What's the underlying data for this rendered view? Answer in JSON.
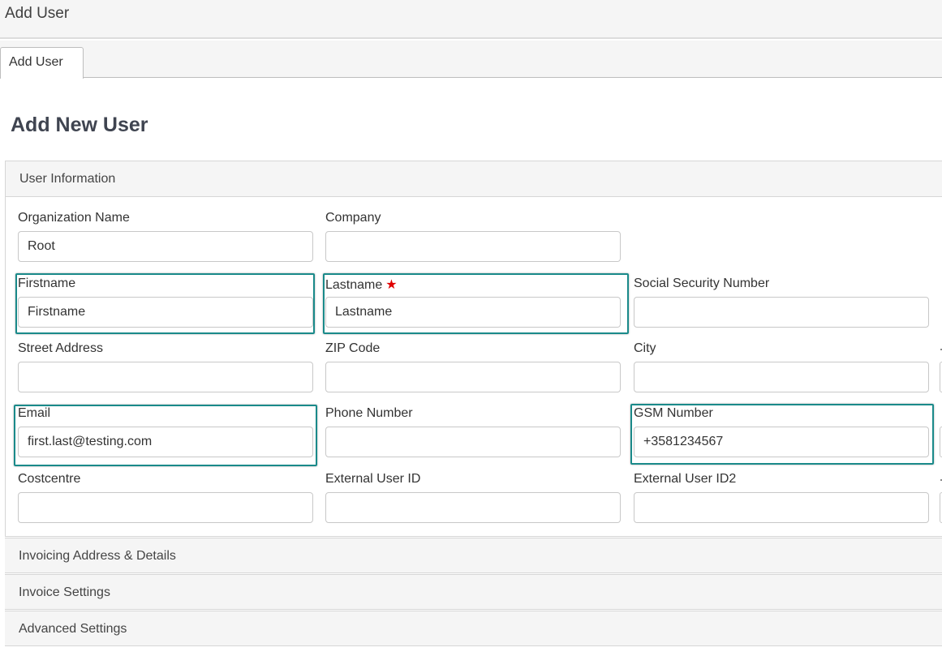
{
  "window": {
    "title": "Add User"
  },
  "tabs": [
    {
      "label": "Add User"
    }
  ],
  "page": {
    "title": "Add New User"
  },
  "user_information": {
    "title": "User Information",
    "fields": {
      "organization_name": {
        "label": "Organization Name",
        "value": "Root"
      },
      "company": {
        "label": "Company",
        "value": ""
      },
      "firstname": {
        "label": "Firstname",
        "value": "Firstname"
      },
      "lastname": {
        "label": "Lastname",
        "value": "Lastname",
        "required_mark": "★"
      },
      "social_security_number": {
        "label": "Social Security Number",
        "value": ""
      },
      "street_address": {
        "label": "Street Address",
        "value": ""
      },
      "zip_code": {
        "label": "ZIP Code",
        "value": ""
      },
      "city": {
        "label": "City",
        "value": ""
      },
      "email": {
        "label": "Email",
        "value": "first.last@testing.com"
      },
      "phone_number": {
        "label": "Phone Number",
        "value": ""
      },
      "gsm_number": {
        "label": "GSM Number",
        "value": "+3581234567"
      },
      "costcentre": {
        "label": "Costcentre",
        "value": ""
      },
      "external_user_id": {
        "label": "External User ID",
        "value": ""
      },
      "external_user_id2": {
        "label": "External User ID2",
        "value": ""
      }
    }
  },
  "sections": [
    {
      "label": "Invoicing Address & Details"
    },
    {
      "label": "Invoice Settings"
    },
    {
      "label": "Advanced Settings"
    }
  ],
  "colors": {
    "highlight": "#1a8a8a",
    "required": "#e00000",
    "title": "#3f4450"
  }
}
